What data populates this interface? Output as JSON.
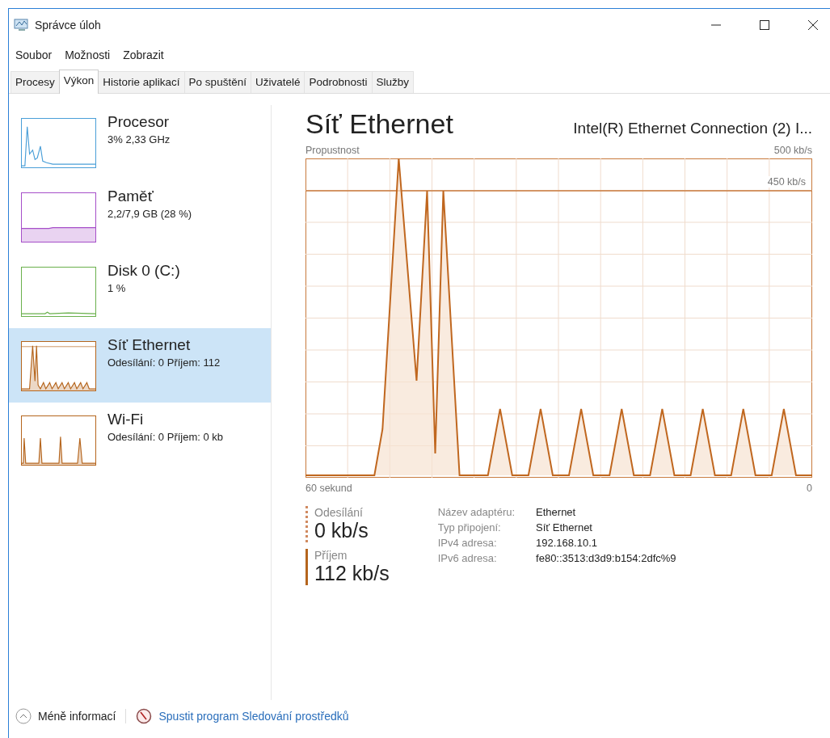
{
  "window": {
    "title": "Správce úloh"
  },
  "menu": [
    "Soubor",
    "Možnosti",
    "Zobrazit"
  ],
  "tabs": [
    {
      "label": "Procesy",
      "selected": false
    },
    {
      "label": "Výkon",
      "selected": true
    },
    {
      "label": "Historie aplikací",
      "selected": false
    },
    {
      "label": "Po spuštění",
      "selected": false
    },
    {
      "label": "Uživatelé",
      "selected": false
    },
    {
      "label": "Podrobnosti",
      "selected": false
    },
    {
      "label": "Služby",
      "selected": false
    }
  ],
  "sidebar": {
    "items": [
      {
        "kind": "cpu",
        "name": "Procesor",
        "detail": "3% 2,33 GHz",
        "color": "#4a9fd8",
        "selected": false
      },
      {
        "kind": "memory",
        "name": "Paměť",
        "detail": "2,2/7,9 GB (28 %)",
        "color": "#a64fc9",
        "selected": false
      },
      {
        "kind": "disk",
        "name": "Disk 0 (C:)",
        "detail": "1 %",
        "color": "#6ab04c",
        "selected": false
      },
      {
        "kind": "network",
        "name": "Síť Ethernet",
        "detail": "Odesílání: 0 Příjem: 112",
        "color": "#b5651d",
        "selected": true
      },
      {
        "kind": "wifi",
        "name": "Wi-Fi",
        "detail": "Odesílání: 0 Příjem: 0 kb",
        "color": "#b5651d",
        "selected": false
      }
    ]
  },
  "main": {
    "title": "Síť Ethernet",
    "adapter": "Intel(R) Ethernet Connection (2) I...",
    "graph": {
      "label": "Propustnost",
      "max": "500 kb/s",
      "marker": "450 kb/s",
      "x_start": "60 sekund",
      "x_end": "0"
    },
    "stats": [
      {
        "kind": "dotted",
        "label": "Odesílání",
        "value": "0 kb/s"
      },
      {
        "kind": "solid",
        "label": "Příjem",
        "value": "112 kb/s"
      }
    ],
    "details": [
      {
        "label": "Název adaptéru:",
        "value": "Ethernet"
      },
      {
        "label": "Typ připojení:",
        "value": "Síť Ethernet"
      },
      {
        "label": "IPv4 adresa:",
        "value": "192.168.10.1"
      },
      {
        "label": "IPv6 adresa:",
        "value": "fe80::3513:d3d9:b154:2dfc%9"
      }
    ]
  },
  "footer": {
    "less": "Méně informací",
    "link": "Spustit program Sledování prostředků"
  }
}
